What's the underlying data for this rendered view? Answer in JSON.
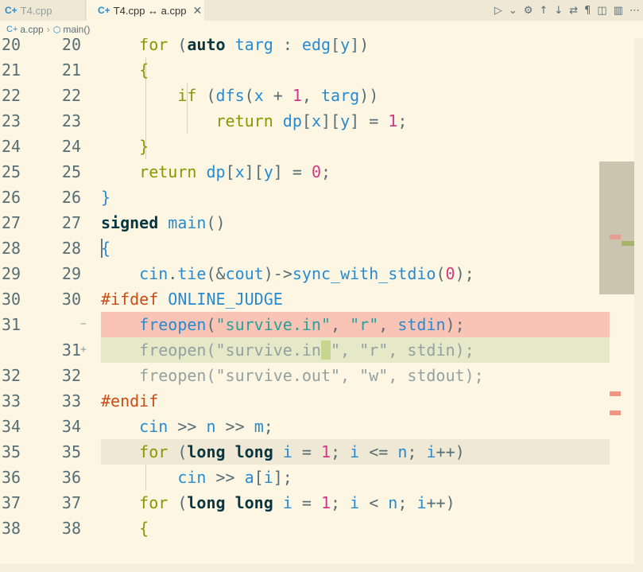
{
  "tabs": [
    {
      "icon": "C+",
      "label": "T4.cpp"
    },
    {
      "icon": "C+",
      "label": "T4.cpp ↔ a.cpp"
    }
  ],
  "actions": [
    "▷",
    "⌄",
    "⚙",
    "↑",
    "↓",
    "⇄",
    "¶",
    "◫",
    "▥",
    "⋯"
  ],
  "breadcrumb": {
    "file": "a.cpp",
    "symbol": "main()"
  },
  "lines": [
    {
      "l": "20",
      "r": "20",
      "html": "    <span class=\"kw\">for</span> (<span class=\"b\">auto</span> <span class=\"fn\">targ</span> : <span class=\"fn\">edg</span>[<span class=\"fn\">y</span>])"
    },
    {
      "l": "21",
      "r": "21",
      "html": "    <span class=\"kw\">{</span>"
    },
    {
      "l": "22",
      "r": "22",
      "html": "        <span class=\"kw\">if</span> (<span class=\"fn\">dfs</span>(<span class=\"fn\">x</span> + <span class=\"num\">1</span>, <span class=\"fn\">targ</span>))"
    },
    {
      "l": "23",
      "r": "23",
      "html": "            <span class=\"kw\">return</span> <span class=\"fn\">dp</span>[<span class=\"fn\">x</span>][<span class=\"fn\">y</span>] = <span class=\"num\">1</span>;"
    },
    {
      "l": "24",
      "r": "24",
      "html": "    <span class=\"kw\">}</span>"
    },
    {
      "l": "25",
      "r": "25",
      "html": "    <span class=\"kw\">return</span> <span class=\"fn\">dp</span>[<span class=\"fn\">x</span>][<span class=\"fn\">y</span>] = <span class=\"num\">0</span>;"
    },
    {
      "l": "26",
      "r": "26",
      "html": "<span class=\"fn\">}</span>"
    },
    {
      "l": "27",
      "r": "27",
      "html": "<span class=\"b\">signed</span> <span class=\"fn\">main</span>()"
    },
    {
      "l": "28",
      "r": "28",
      "html": "<span class=\"fn\">{</span>"
    },
    {
      "l": "29",
      "r": "29",
      "html": "    <span class=\"fn\">cin</span>.<span class=\"fn\">tie</span>(&<span class=\"fn\">cout</span>)-><span class=\"fn\">sync_with_stdio</span>(<span class=\"num\">0</span>);"
    },
    {
      "l": "30",
      "r": "30",
      "html": "<span class=\"pp\">#ifdef</span> <span class=\"fn\">ONLINE_JUDGE</span>"
    },
    {
      "l": "31",
      "r": "",
      "mark": "−",
      "html": "    <span class=\"fn\">freopen</span>(<span class=\"str\">\"survive.in\"</span>, <span class=\"str\">\"r\"</span>, <span class=\"fn\">stdin</span>);"
    },
    {
      "l": "",
      "r": "31",
      "mark": "+",
      "html": "<span class=\"dim\">    freopen(\"survive.in<span class=\"ch-ins\"> </span>\", \"r\", stdin);</span>"
    },
    {
      "l": "32",
      "r": "32",
      "html": "<span class=\"dim\">    freopen(\"survive.out\", \"w\", stdout);</span>"
    },
    {
      "l": "33",
      "r": "33",
      "html": "<span class=\"pp\">#endif</span>"
    },
    {
      "l": "34",
      "r": "34",
      "html": "    <span class=\"fn\">cin</span> >> <span class=\"fn\">n</span> >> <span class=\"fn\">m</span>;"
    },
    {
      "l": "35",
      "r": "35",
      "html": "    <span class=\"kw\">for</span> (<span class=\"b\">long long</span> <span class=\"fn\">i</span> = <span class=\"num\">1</span>; <span class=\"fn\">i</span> <= <span class=\"fn\">n</span>; <span class=\"fn\">i</span>++)"
    },
    {
      "l": "36",
      "r": "36",
      "html": "        <span class=\"fn\">cin</span> >> <span class=\"fn\">a</span>[<span class=\"fn\">i</span>];"
    },
    {
      "l": "37",
      "r": "37",
      "html": "    <span class=\"kw\">for</span> (<span class=\"b\">long long</span> <span class=\"fn\">i</span> = <span class=\"num\">1</span>; <span class=\"fn\">i</span> < <span class=\"fn\">n</span>; <span class=\"fn\">i</span>++)"
    },
    {
      "l": "38",
      "r": "38",
      "html": "    <span class=\"kw\">{</span>"
    }
  ],
  "colors": {
    "removed_line": "#f9c3b5",
    "added_line": "#e6e9c8",
    "current_line": "#eee8d5"
  }
}
